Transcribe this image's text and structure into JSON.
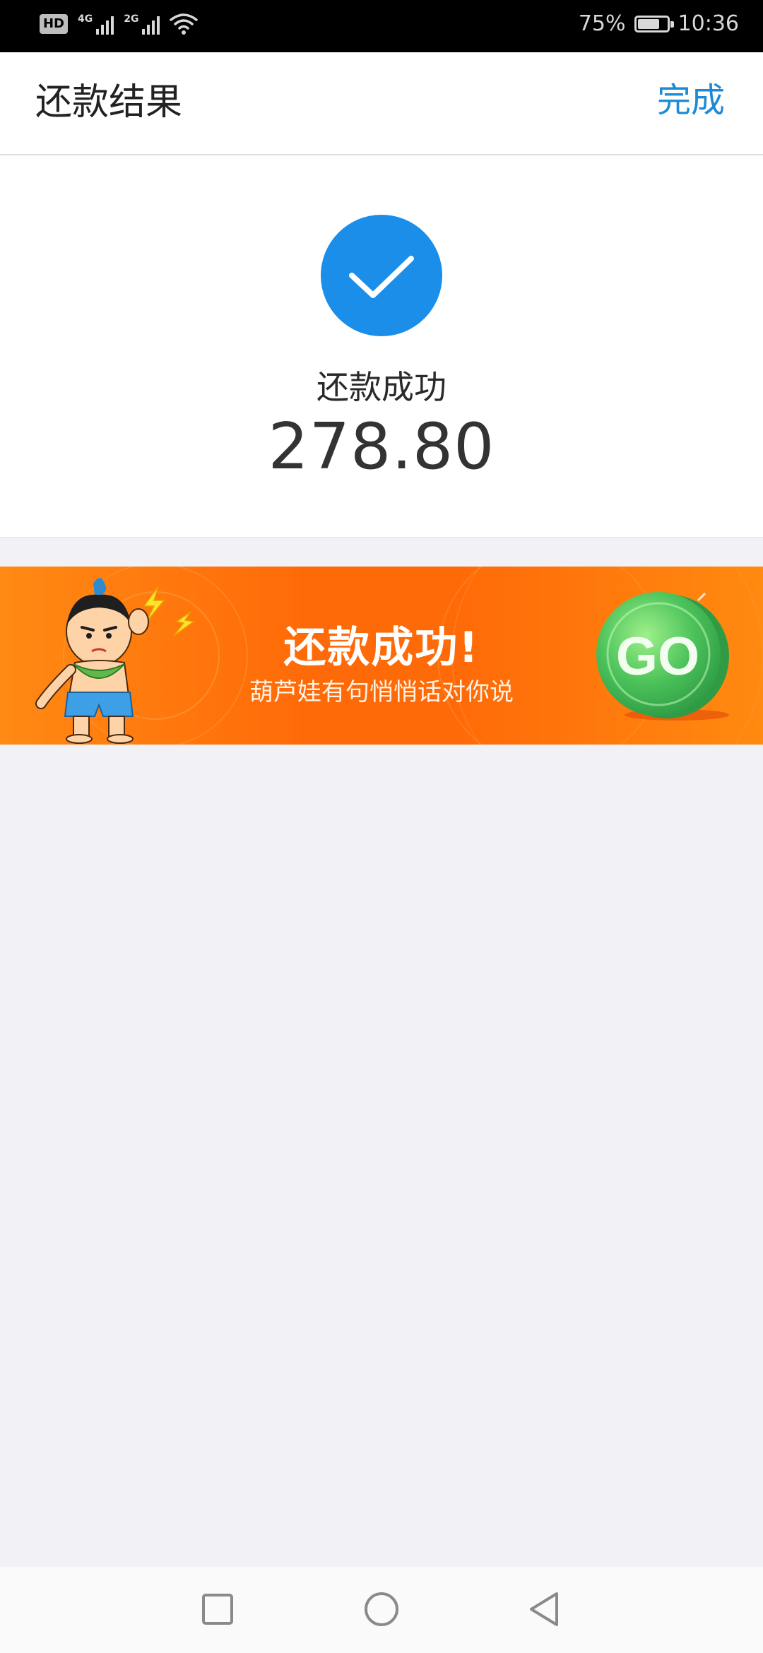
{
  "status_bar": {
    "hd": "HD",
    "sim1_type": "4G",
    "sim2_type": "2G",
    "battery": "75%",
    "battery_level": 0.75,
    "time": "10:36"
  },
  "header": {
    "title": "还款结果",
    "done_label": "完成"
  },
  "result": {
    "status_text": "还款成功",
    "amount": "278.80",
    "icon": "check-icon",
    "accent_color": "#1a8ee9"
  },
  "banner": {
    "title": "还款成功!",
    "subtitle": "葫芦娃有句悄悄话对你说",
    "go_label": "GO",
    "background_color": "#ff6a08"
  },
  "nav_bar": {
    "icons": [
      "recent-apps-icon",
      "home-icon",
      "back-icon"
    ]
  }
}
